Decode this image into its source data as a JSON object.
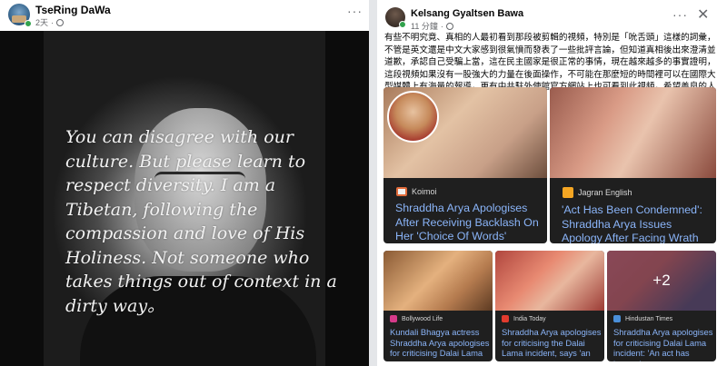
{
  "left_post": {
    "author": "TseRing DaWa",
    "time": "2天",
    "privacy_icon": "globe-icon",
    "more_icon": "more-options-icon",
    "more_label": "···",
    "image_quote": "You can disagree with our culture. But please learn to respect diversity. I am a Tibetan, following the compassion and love of His Holiness. Not someone who takes things out of context in a dirty way。"
  },
  "right_post": {
    "author": "Kelsang Gyaltsen Bawa",
    "time": "11 分鐘",
    "privacy_icon": "globe-icon",
    "more_label": "···",
    "close_label": "✕",
    "body": "有些不明究竟、真相的人最初看到那段被剪輯的視頻，特別是「吮舌頭」這樣的詞彙，不管是英文還是中文大家感到很氣憤而發表了一些批評言論，但知道真相後出來澄清並道歉，承認自己受騙上當，這在民主國家是很正常的事情，現在越來越多的事實證明，這段視頻如果沒有一股強大的力量在後面操作，不可能在那麼短的時間裡可以在國際大型媒體上有海量的報導，更有中共駐外使館官方網站上也可看到此視頻，希望善良的人們提高警覺！",
    "cards": [
      {
        "source": "Koimoi",
        "title": "Shraddha Arya Apologises After Receiving Backlash On Her 'Choice Of Words' Criticising Dalai Lama:"
      },
      {
        "source": "Jagran English",
        "title": "'Act Has Been Condemned': Shraddha Arya Issues Apology After Facing Wrath"
      },
      {
        "source": "Bollywood Life",
        "title": "Kundali Bhagya actress Shraddha Arya apologises for criticising Dalai Lama"
      },
      {
        "source": "India Today",
        "title": "Shraddha Arya apologises for criticising the Dalai Lama incident, says 'an act"
      },
      {
        "source": "Hindustan Times",
        "title": "Shraddha Arya apologises for criticising Dalai Lama incident: 'An act has been...'",
        "more_count": "+2"
      }
    ]
  }
}
